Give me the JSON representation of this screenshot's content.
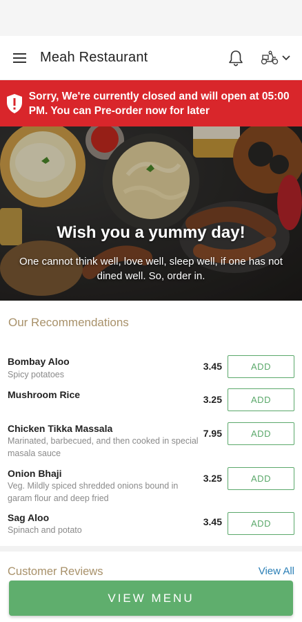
{
  "header": {
    "title": "Meah Restaurant",
    "menu_icon": "hamburger-menu-icon",
    "bell_icon": "bell-icon",
    "delivery_icon": "delivery-scooter-icon"
  },
  "banner": {
    "message": "Sorry, We're currently closed and will open at 05:00 PM. You can Pre-order now for later",
    "icon": "shield-alert-icon",
    "color": "#d9262b"
  },
  "hero": {
    "title": "Wish you a yummy day!",
    "subtitle": "One cannot think well, love well, sleep well, if one has not dined well. So, order in."
  },
  "recommendations": {
    "title": "Our Recommendations",
    "items": [
      {
        "name": "Bombay Aloo",
        "desc": "Spicy potatoes",
        "price": "3.45",
        "button": "ADD"
      },
      {
        "name": "Mushroom Rice",
        "desc": "",
        "price": "3.25",
        "button": "ADD"
      },
      {
        "name": "Chicken Tikka Massala",
        "desc": "Marinated, barbecued, and then cooked in special masala sauce",
        "price": "7.95",
        "button": "ADD"
      },
      {
        "name": "Onion Bhaji",
        "desc": "Veg. Mildly spiced shredded onions bound in garam flour and deep fried",
        "price": "3.25",
        "button": "ADD"
      },
      {
        "name": "Sag Aloo",
        "desc": "Spinach and potato",
        "price": "3.45",
        "button": "ADD"
      }
    ]
  },
  "reviews": {
    "title": "Customer Reviews",
    "view_all": "View All"
  },
  "view_menu_label": "VIEW MENU",
  "colors": {
    "accent_green": "#5fae6d",
    "section_gold": "#a8916a",
    "link_blue": "#2b7fb6"
  }
}
